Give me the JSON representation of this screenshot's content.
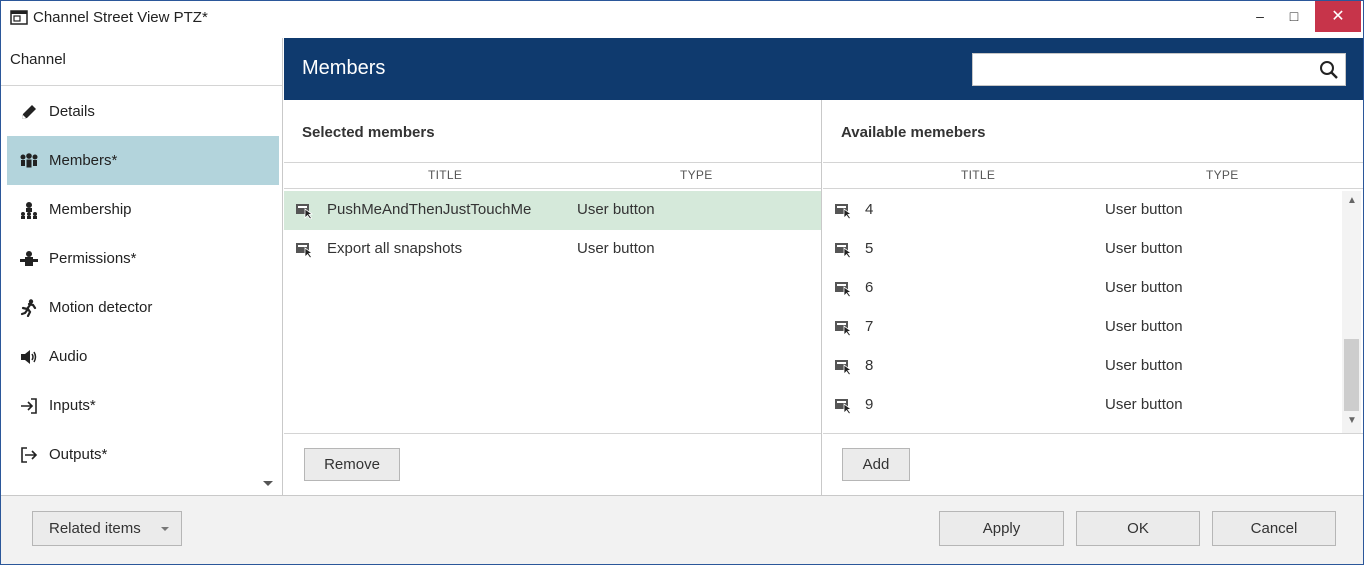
{
  "window": {
    "title": "Channel Street View PTZ*",
    "controls": {
      "minimize": "–",
      "maximize": "□",
      "close": "✕"
    }
  },
  "nav": {
    "header": "Channel",
    "items": [
      {
        "label": "Details",
        "icon": "pencil-icon"
      },
      {
        "label": "Members*",
        "icon": "members-icon",
        "active": true
      },
      {
        "label": "Membership",
        "icon": "membership-icon"
      },
      {
        "label": "Permissions*",
        "icon": "permissions-icon"
      },
      {
        "label": "Motion detector",
        "icon": "motion-icon"
      },
      {
        "label": "Audio",
        "icon": "audio-icon"
      },
      {
        "label": "Inputs*",
        "icon": "inputs-icon"
      },
      {
        "label": "Outputs*",
        "icon": "outputs-icon"
      }
    ]
  },
  "main": {
    "title": "Members",
    "search": {
      "value": "",
      "placeholder": ""
    }
  },
  "selected": {
    "title": "Selected members",
    "columns": {
      "title": "TITLE",
      "type": "TYPE"
    },
    "rows": [
      {
        "title": "PushMeAndThenJustTouchMe",
        "type": "User button",
        "selected": true
      },
      {
        "title": "Export all snapshots",
        "type": "User button"
      }
    ],
    "remove_label": "Remove"
  },
  "available": {
    "title": "Available memebers",
    "columns": {
      "title": "TITLE",
      "type": "TYPE"
    },
    "rows": [
      {
        "title": "4",
        "type": "User button"
      },
      {
        "title": "5",
        "type": "User button"
      },
      {
        "title": "6",
        "type": "User button"
      },
      {
        "title": "7",
        "type": "User button"
      },
      {
        "title": "8",
        "type": "User button"
      },
      {
        "title": "9",
        "type": "User button"
      }
    ],
    "add_label": "Add"
  },
  "footer": {
    "related_label": "Related items",
    "apply_label": "Apply",
    "ok_label": "OK",
    "cancel_label": "Cancel"
  },
  "colors": {
    "header_bg": "#0f3a6e",
    "nav_active": "#b3d4dc",
    "row_selected": "#d5e9da",
    "close_button": "#c7344a"
  }
}
